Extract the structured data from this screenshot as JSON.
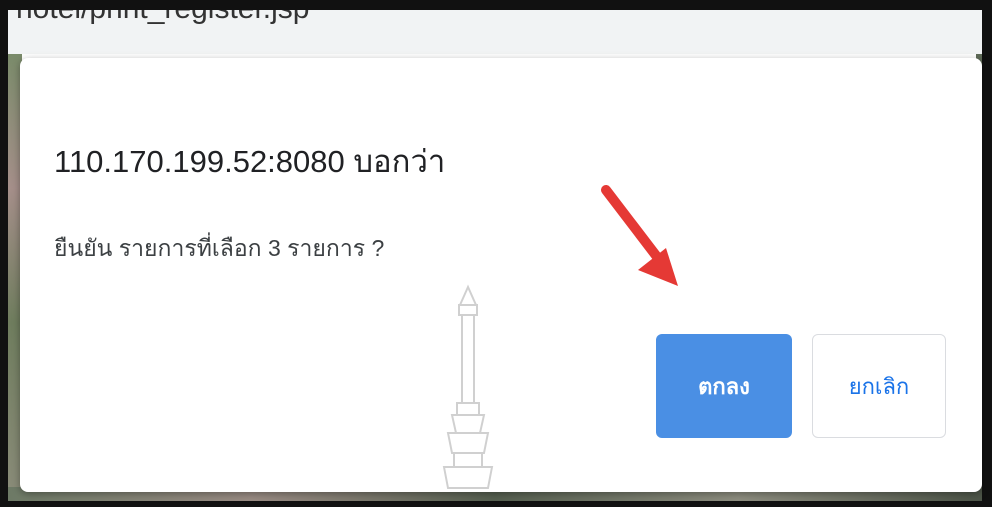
{
  "url_bar": {
    "text": "hotel/print_register.jsp"
  },
  "dialog": {
    "title": "110.170.199.52:8080 บอกว่า",
    "message": "ยืนยัน รายการที่เลือก 3 รายการ ?",
    "ok_label": "ตกลง",
    "cancel_label": "ยกเลิก"
  },
  "colors": {
    "ok_button_bg": "#4a8fe4",
    "cancel_text": "#1a73e8",
    "annotation_arrow": "#e53935"
  },
  "icons": {
    "annotation": "red-arrow-icon",
    "watermark": "university-emblem-watermark"
  }
}
